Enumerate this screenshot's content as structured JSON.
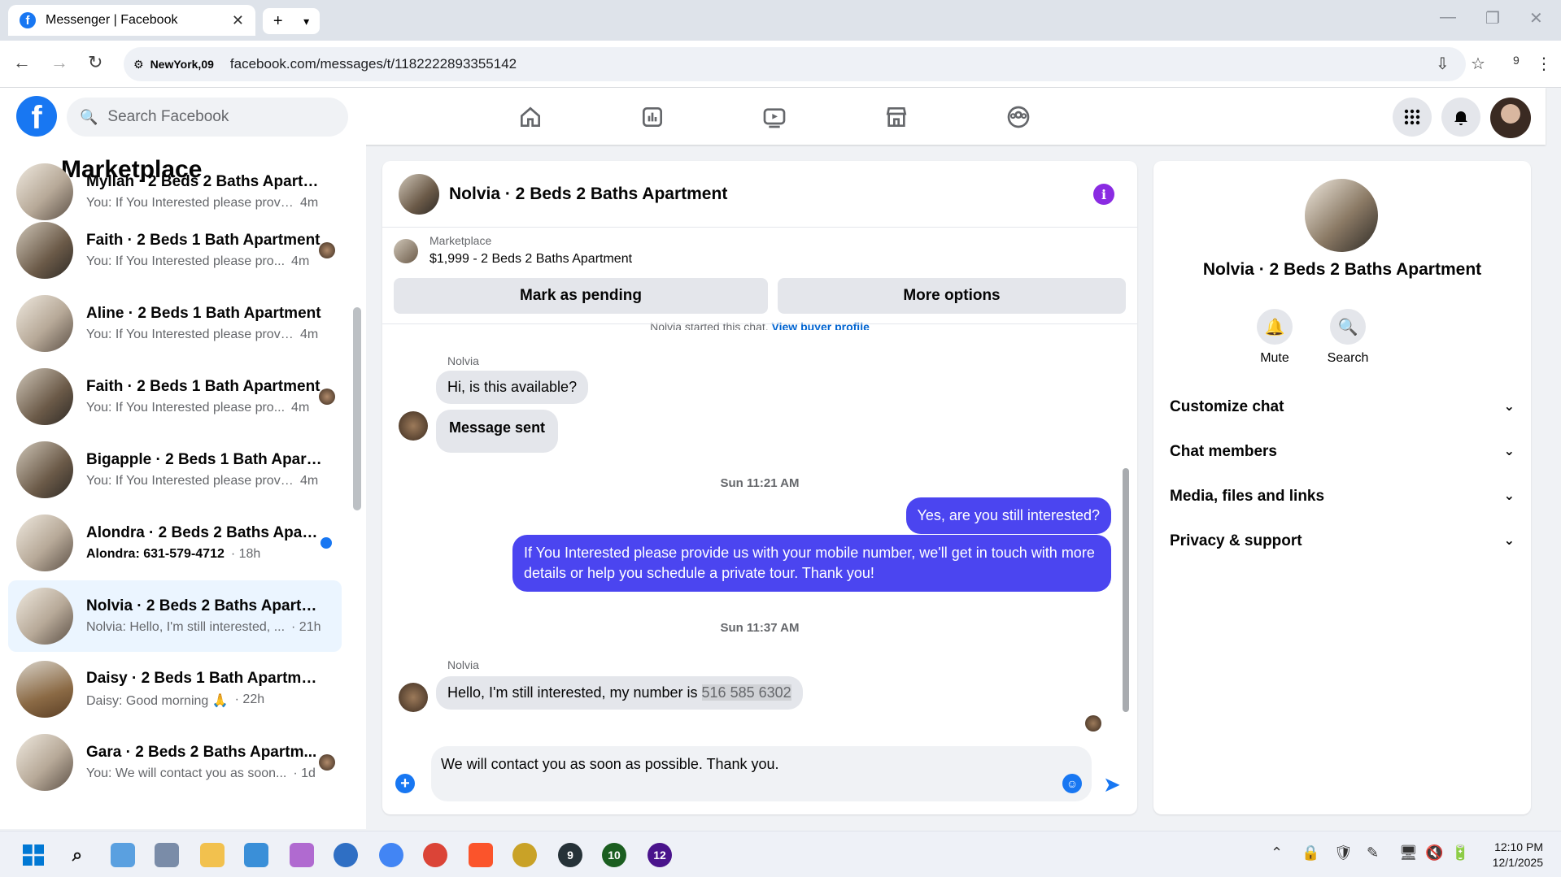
{
  "browser": {
    "tab_title": "Messenger | Facebook",
    "site_chip": "NewYork,09",
    "url": "facebook.com/messages/t/1182222893355142",
    "extension_count": "9"
  },
  "header": {
    "search_placeholder": "Search Facebook"
  },
  "sidebar": {
    "title": "Marketplace",
    "conversations": [
      {
        "name": "Myllah · 2 Beds 2 Baths Apartme...",
        "snippet": "You: If You Interested please provi...",
        "time": "4m"
      },
      {
        "name": "Faith · 2 Beds 1 Bath Apartment",
        "snippet": "You: If You Interested please pro...",
        "time": "4m"
      },
      {
        "name": "Aline · 2 Beds 1 Bath Apartment",
        "snippet": "You: If You Interested please provi...",
        "time": "4m"
      },
      {
        "name": "Faith · 2 Beds 1 Bath Apartment",
        "snippet": "You: If You Interested please pro...",
        "time": "4m"
      },
      {
        "name": "Bigapple · 2 Beds 1 Bath Apartm...",
        "snippet": "You: If You Interested please provi...",
        "time": "4m"
      },
      {
        "name": "Alondra · 2 Beds 2 Baths Apart...",
        "snippet": "Alondra: 631-579-4712",
        "time": "· 18h"
      },
      {
        "name": "Nolvia · 2 Beds 2 Baths Apartment",
        "snippet": "Nolvia: Hello, I'm still interested, ...",
        "time": "· 21h"
      },
      {
        "name": "Daisy · 2 Beds 1 Bath Apartment",
        "snippet": "Daisy: Good morning 🙏",
        "time": "· 22h"
      },
      {
        "name": "Gara · 2 Beds 2 Baths Apartm...",
        "snippet": "You: We will contact you as soon...",
        "time": "· 1d"
      }
    ]
  },
  "chat": {
    "title": "Nolvia · 2 Beds 2 Baths Apartment",
    "marketplace_label": "Marketplace",
    "listing": "$1,999 - 2 Beds 2 Baths Apartment",
    "mark_pending": "Mark as pending",
    "more_options": "More options",
    "started_text": "Nolvia started this chat.",
    "view_buyer": "View buyer profile",
    "sender1": "Nolvia",
    "msg1": "Hi, is this available?",
    "msg2": "Message sent",
    "stamp1": "Sun 11:21 AM",
    "out1": "Yes, are you still interested?",
    "out2": "If You Interested please provide us with your mobile number, we'll get in touch with more details or help you schedule a private tour. Thank you!",
    "stamp2": "Sun 11:37 AM",
    "sender2": "Nolvia",
    "msg3_prefix": "Hello, I'm still interested, my number is ",
    "msg3_number": "516 585 6302",
    "composer_text": "We will contact you as soon as possible. Thank you."
  },
  "info": {
    "name": "Nolvia · 2 Beds 2 Baths Apartment",
    "mute": "Mute",
    "search": "Search",
    "sections": [
      "Customize chat",
      "Chat members",
      "Media, files and links",
      "Privacy & support"
    ]
  },
  "taskbar": {
    "time": "12:10 PM",
    "date": "12/1/2025",
    "badges": [
      "9",
      "10",
      "12"
    ]
  },
  "colors": {
    "fb_blue": "#1877f2",
    "outgoing_bubble": "#4b45f0",
    "active_conversation": "#ebf5ff"
  }
}
